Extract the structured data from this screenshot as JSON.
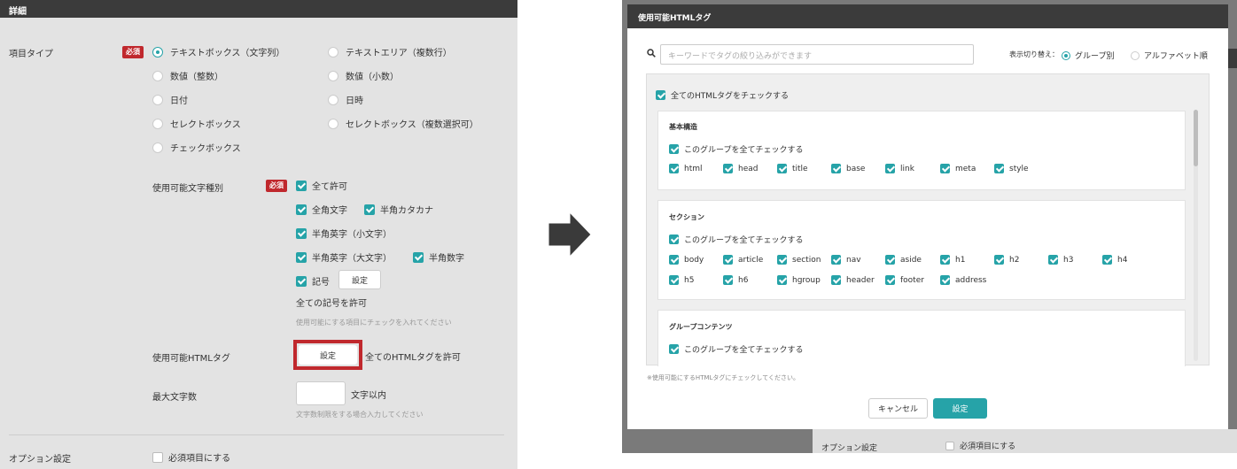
{
  "left": {
    "header": "詳細",
    "item_type": {
      "label": "項目タイプ",
      "required": "必須",
      "options": [
        "テキストボックス（文字列）",
        "テキストエリア（複数行）",
        "数値（整数）",
        "数値（小数）",
        "日付",
        "日時",
        "セレクトボックス",
        "セレクトボックス（複数選択可）",
        "チェックボックス"
      ],
      "selected": "テキストボックス（文字列）"
    },
    "char_types": {
      "label": "使用可能文字種別",
      "required": "必須",
      "all": "全て許可",
      "zenkaku": "全角文字",
      "hankaku_kana": "半角カタカナ",
      "lower": "半角英字（小文字）",
      "upper": "半角英字（大文字）",
      "digits": "半角数字",
      "symbols": "記号",
      "symbols_button": "設定",
      "symbols_status": "全ての記号を許可",
      "hint": "使用可能にする項目にチェックを入れてください"
    },
    "html_tags": {
      "label": "使用可能HTMLタグ",
      "button": "設定",
      "status": "全てのHTMLタグを許可"
    },
    "max_chars": {
      "label": "最大文字数",
      "value": "",
      "suffix": "文字以内",
      "hint": "文字数制限をする場合入力してください"
    },
    "option": {
      "label": "オプション設定",
      "required_check": "必須項目にする"
    }
  },
  "dialog": {
    "title": "使用可能HTMLタグ",
    "search_placeholder": "キーワードでタグの絞り込みができます",
    "view_label": "表示切り替え：",
    "view_group": "グループ別",
    "view_alpha": "アルファベット順",
    "check_all": "全てのHTMLタグをチェックする",
    "groups": [
      {
        "title": "基本構造",
        "check_group": "このグループを全てチェックする",
        "tags": [
          "html",
          "head",
          "title",
          "base",
          "link",
          "meta",
          "style"
        ]
      },
      {
        "title": "セクション",
        "check_group": "このグループを全てチェックする",
        "tags": [
          "body",
          "article",
          "section",
          "nav",
          "aside",
          "h1",
          "h2",
          "h3",
          "h4",
          "h5",
          "h6",
          "hgroup",
          "header",
          "footer",
          "address"
        ]
      },
      {
        "title": "グループコンテンツ",
        "check_group": "このグループを全てチェックする",
        "tags": []
      }
    ],
    "note": "※使用可能にするHTMLタグにチェックしてください。",
    "cancel": "キャンセル",
    "ok": "設定"
  },
  "background": {
    "option_label": "オプション設定",
    "required_check": "必須項目にする"
  },
  "colors": {
    "accent": "#26a3a8",
    "required": "#c0282d",
    "header": "#3b3b3b"
  }
}
